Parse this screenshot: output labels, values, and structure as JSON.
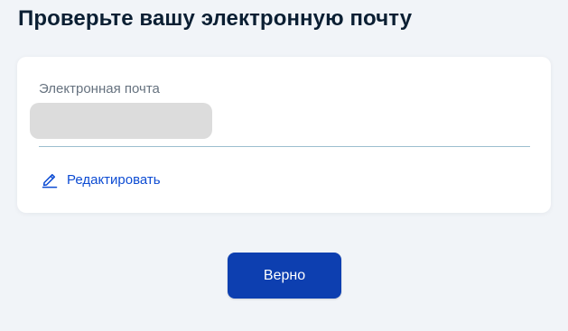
{
  "page": {
    "title": "Проверьте вашу электронную почту"
  },
  "email_card": {
    "field_label": "Электронная почта",
    "field_value": "",
    "edit_icon": "pencil-icon",
    "edit_label": "Редактировать"
  },
  "actions": {
    "confirm_label": "Верно"
  },
  "colors": {
    "background": "#f1f4f8",
    "card": "#ffffff",
    "title": "#0b1f33",
    "label": "#66727f",
    "link": "#0d4cd3",
    "primary_button": "#0d3fb0",
    "masked_value": "#dcdcdc"
  }
}
